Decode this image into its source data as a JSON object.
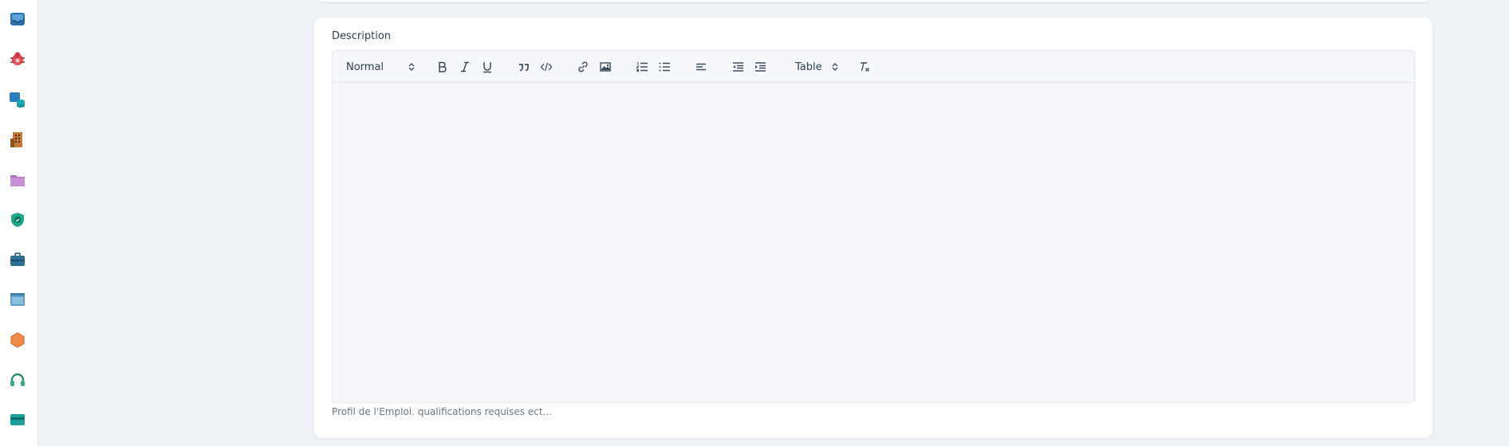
{
  "sidebar": {
    "icons": [
      {
        "name": "inbox-icon",
        "color": "#2a6fa8"
      },
      {
        "name": "bug-icon",
        "color": "#e0525a"
      },
      {
        "name": "database-icon",
        "color": "#1fa3b6"
      },
      {
        "name": "building-icon",
        "color": "#c47a35"
      },
      {
        "name": "folder-icon",
        "color": "#b36fc2"
      },
      {
        "name": "shield-check-icon",
        "color": "#1ea58a"
      },
      {
        "name": "briefcase-icon",
        "color": "#2c6f95"
      },
      {
        "name": "window-icon",
        "color": "#5e9fc3"
      },
      {
        "name": "hexagon-icon",
        "color": "#f08a4b"
      },
      {
        "name": "headset-icon",
        "color": "#2f8a70"
      },
      {
        "name": "card-icon",
        "color": "#1a9f9a"
      }
    ]
  },
  "form": {
    "description_label": "Description",
    "helper_text": "Profil de l'Emploi. qualifications requises ect..."
  },
  "editor": {
    "heading_picker": "Normal",
    "table_picker": "Table",
    "content": ""
  }
}
